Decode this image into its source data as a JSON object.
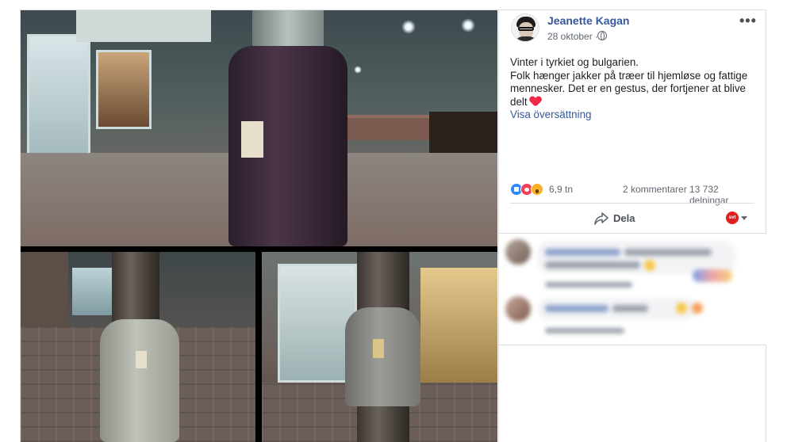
{
  "post": {
    "author": "Jeanette Kagan",
    "date": "28 oktober ·",
    "more_label": "•••",
    "text_line1": "Vinter i tyrkiet og bulgarien.",
    "text_line2": "Folk hænger jakker på træer til hjemløse og fattige mennesker. Det er en gestus, der fortjener at blive delt",
    "translate_label": "Visa översättning"
  },
  "stats": {
    "reaction_count": "6,9 tn",
    "comments": "2 kommentarer",
    "shares": "13 732 delningar",
    "reactions": [
      "like-icon",
      "love-icon",
      "wow-icon"
    ]
  },
  "actions": {
    "share_label": "Dela",
    "profile_badge": "svt"
  },
  "colors": {
    "link": "#365899",
    "text": "#1c1e21",
    "meta": "#616770",
    "like": "#2d88ff",
    "love": "#f33e58",
    "wow": "#f7b125"
  }
}
